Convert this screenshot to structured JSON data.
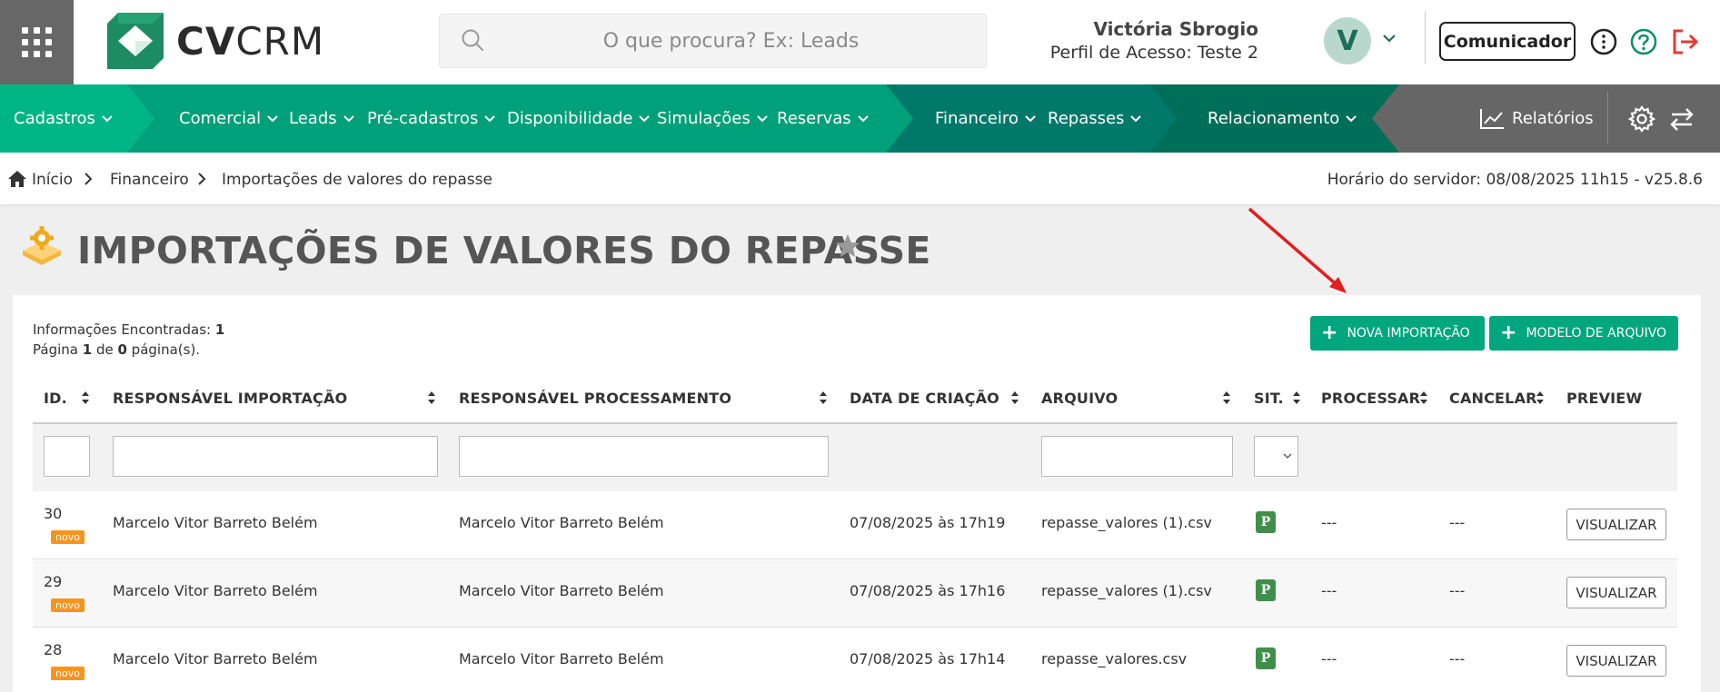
{
  "header": {
    "logo_bold": "CV",
    "logo_light": "CRM",
    "search_placeholder": "O que procura? Ex: Leads",
    "user_name": "Victória Sbrogio",
    "user_profile": "Perfil de Acesso: Teste 2",
    "avatar_letter": "V",
    "communicator_label": "Comunicador"
  },
  "nav": {
    "items": [
      "Cadastros",
      "Comercial",
      "Leads",
      "Pré-cadastros",
      "Disponibilidade",
      "Simulações",
      "Reservas",
      "Financeiro",
      "Repasses",
      "Relacionamento"
    ],
    "reports_label": "Relatórios",
    "colors": {
      "seg1": "#00b585",
      "seg2": "#00a07a",
      "seg3": "#008a6c",
      "seg4": "#006f5a",
      "rest": "#666666"
    }
  },
  "breadcrumb": {
    "items": [
      "Início",
      "Financeiro",
      "Importações de valores do repasse"
    ],
    "server_time": "Horário do servidor: 08/08/2025 11h15 - v25.8.6"
  },
  "page": {
    "title": "IMPORTAÇÕES DE VALORES DO REPASSE"
  },
  "panel": {
    "info_found_label": "Informações Encontradas: ",
    "info_found_value": "1",
    "page_label_1": "Página ",
    "page_current": "1",
    "page_label_2": " de ",
    "page_total": "0",
    "page_label_3": " página(s).",
    "btn_new_import": "NOVA IMPORTAÇÃO",
    "btn_file_model": "MODELO DE ARQUIVO"
  },
  "table": {
    "headers": [
      "ID.",
      "RESPONSÁVEL IMPORTAÇÃO",
      "RESPONSÁVEL PROCESSAMENTO",
      "DATA DE CRIAÇÃO",
      "ARQUIVO",
      "SIT.",
      "PROCESSAR",
      "CANCELAR",
      "PREVIEW"
    ],
    "rows": [
      {
        "id": "30",
        "badge": "novo",
        "resp_import": "Marcelo Vitor Barreto Belém",
        "resp_process": "Marcelo Vitor Barreto Belém",
        "created": "07/08/2025 às 17h19",
        "file": "repasse_valores (1).csv",
        "status": "P",
        "process": "---",
        "cancel": "---",
        "preview": "VISUALIZAR"
      },
      {
        "id": "29",
        "badge": "novo",
        "resp_import": "Marcelo Vitor Barreto Belém",
        "resp_process": "Marcelo Vitor Barreto Belém",
        "created": "07/08/2025 às 17h16",
        "file": "repasse_valores (1).csv",
        "status": "P",
        "process": "---",
        "cancel": "---",
        "preview": "VISUALIZAR"
      },
      {
        "id": "28",
        "badge": "novo",
        "resp_import": "Marcelo Vitor Barreto Belém",
        "resp_process": "Marcelo Vitor Barreto Belém",
        "created": "07/08/2025 às 17h14",
        "file": "repasse_valores.csv",
        "status": "P",
        "process": "---",
        "cancel": "---",
        "preview": "VISUALIZAR"
      }
    ]
  }
}
